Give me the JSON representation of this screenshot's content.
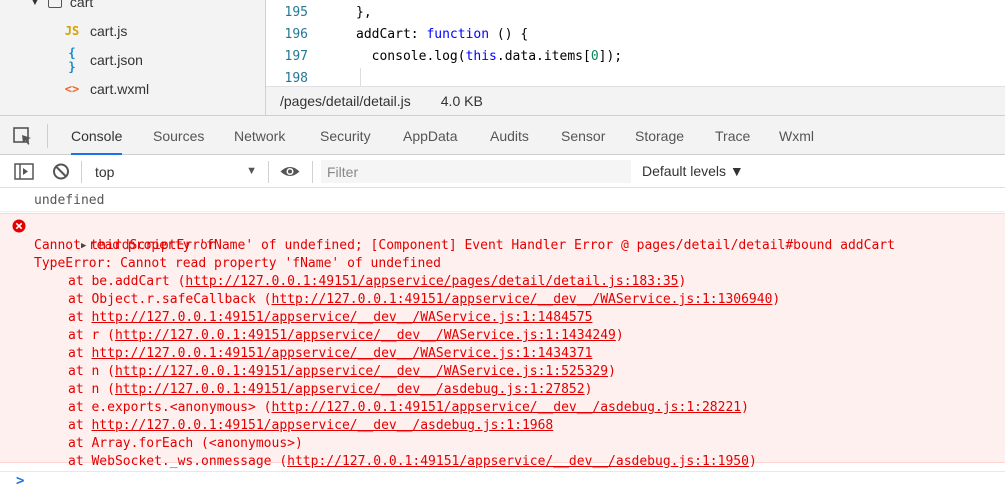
{
  "file_tree": {
    "folder": {
      "label": "cart"
    },
    "files": [
      {
        "icon": "JS",
        "label": "cart.js",
        "icon_color": "#d6a100"
      },
      {
        "icon": "{ }",
        "label": "cart.json",
        "icon_color": "#1a88c9"
      },
      {
        "icon": "<>",
        "label": "cart.wxml",
        "icon_color": "#e8672d"
      }
    ]
  },
  "editor": {
    "line_numbers": [
      "195",
      "196",
      "197",
      "198"
    ],
    "lines": {
      "l195": "},",
      "l196_a": "addCart: ",
      "l196_kw": "function",
      "l196_b": " () {",
      "l197_a": "  console.log(",
      "l197_kw": "this",
      "l197_b": ".data.items[",
      "l197_num": "0",
      "l197_c": "]);"
    },
    "file_path": "/pages/detail/detail.js",
    "file_size": "4.0 KB"
  },
  "devtools": {
    "tabs": [
      "Console",
      "Sources",
      "Network",
      "Security",
      "AppData",
      "Audits",
      "Sensor",
      "Storage",
      "Trace",
      "Wxml"
    ],
    "active_tab": "Console"
  },
  "console_toolbar": {
    "context": "top",
    "filter_placeholder": "Filter",
    "levels": "Default levels ▼"
  },
  "console": {
    "undefined_line": "undefined",
    "error": {
      "title": "thirdScriptError",
      "message": "Cannot read property 'fName' of undefined; [Component] Event Handler Error @ pages/detail/detail#bound addCart",
      "type_line": "TypeError: Cannot read property 'fName' of undefined",
      "stack": [
        {
          "prefix": "at be.addCart (",
          "url": "http://127.0.0.1:49151/appservice/pages/detail/detail.js:183:35",
          "suffix": ")"
        },
        {
          "prefix": "at Object.r.safeCallback (",
          "url": "http://127.0.0.1:49151/appservice/__dev__/WAService.js:1:1306940",
          "suffix": ")"
        },
        {
          "prefix": "at ",
          "url": "http://127.0.0.1:49151/appservice/__dev__/WAService.js:1:1484575",
          "suffix": ""
        },
        {
          "prefix": "at r (",
          "url": "http://127.0.0.1:49151/appservice/__dev__/WAService.js:1:1434249",
          "suffix": ")"
        },
        {
          "prefix": "at ",
          "url": "http://127.0.0.1:49151/appservice/__dev__/WAService.js:1:1434371",
          "suffix": ""
        },
        {
          "prefix": "at n (",
          "url": "http://127.0.0.1:49151/appservice/__dev__/WAService.js:1:525329",
          "suffix": ")"
        },
        {
          "prefix": "at n (",
          "url": "http://127.0.0.1:49151/appservice/__dev__/asdebug.js:1:27852",
          "suffix": ")"
        },
        {
          "prefix": "at e.exports.<anonymous> (",
          "url": "http://127.0.0.1:49151/appservice/__dev__/asdebug.js:1:28221",
          "suffix": ")"
        },
        {
          "prefix": "at ",
          "url": "http://127.0.0.1:49151/appservice/__dev__/asdebug.js:1:1968",
          "suffix": ""
        },
        {
          "prefix": "at Array.forEach (<anonymous>)",
          "url": "",
          "suffix": ""
        },
        {
          "prefix": "at WebSocket._ws.onmessage (",
          "url": "http://127.0.0.1:49151/appservice/__dev__/asdebug.js:1:1950",
          "suffix": ")"
        }
      ]
    },
    "prompt_symbol": ">"
  },
  "colors": {
    "error_text": "#e40000",
    "error_bg": "#fff0f0",
    "accent": "#1a73e8"
  },
  "icons": [
    "inspect-icon",
    "sidebar-toggle-icon",
    "clear-console-icon",
    "eye-icon",
    "error-icon",
    "expand-triangle-icon",
    "folder-caret-icon"
  ]
}
